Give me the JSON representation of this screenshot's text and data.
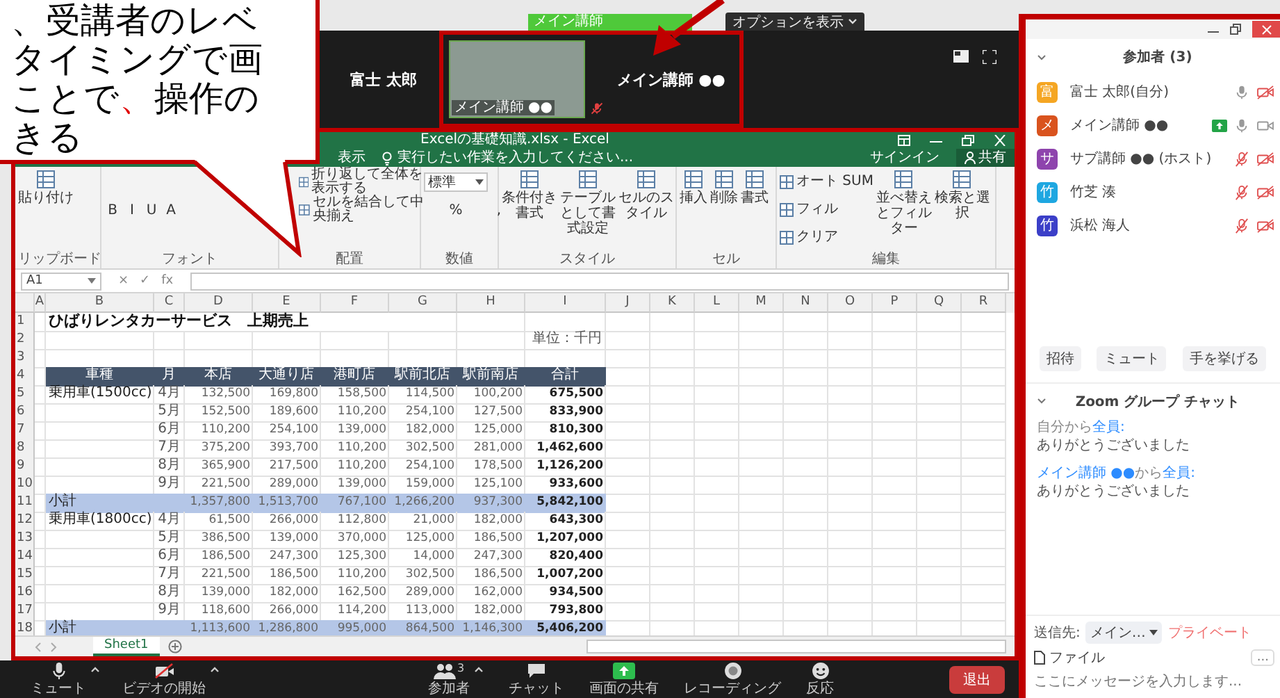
{
  "callout": {
    "lines": [
      [
        {
          "text": "、受講者のレベ",
          "highlight": false
        }
      ],
      [
        {
          "text": "タイミングで画",
          "highlight": false
        }
      ],
      [
        {
          "text": "ことで",
          "highlight": false
        },
        {
          "text": "、",
          "highlight": true
        },
        {
          "text": "操作の",
          "highlight": false
        }
      ],
      [
        {
          "text": "きる",
          "highlight": false
        }
      ]
    ]
  },
  "banner": {
    "text": "メイン講師"
  },
  "options_button": "オプションを表示",
  "video_bar": {
    "self_name": "富士 太郎",
    "speaker_tile_label": "メイン講師 ●●",
    "speaker_mic_muted": true,
    "speaker_name": "メイン講師 ●●"
  },
  "excel": {
    "title": "Excelの基礎知識.xlsx - Excel",
    "menu_tabs": [
      "表示"
    ],
    "tell_me": "実行したい作業を入力してください...",
    "sign_in": "サインイン",
    "share": "共有",
    "ribbon": [
      {
        "label": "リップボード",
        "items": [
          {
            "kind": "large",
            "text": "貼り付け"
          }
        ]
      },
      {
        "label": "フォント",
        "items": [
          {
            "kind": "glyph",
            "text": "B"
          },
          {
            "kind": "glyph",
            "text": "I"
          },
          {
            "kind": "glyph",
            "text": "U"
          },
          {
            "kind": "glyph",
            "text": "A"
          }
        ]
      },
      {
        "label": "配置",
        "items": [
          {
            "kind": "small",
            "text": "折り返して全体を表示する"
          },
          {
            "kind": "small",
            "text": "セルを結合して中央揃え"
          }
        ]
      },
      {
        "label": "数値",
        "items": [
          {
            "kind": "dropdown",
            "text": "標準"
          },
          {
            "kind": "glyph",
            "text": "%"
          },
          {
            "kind": "glyph",
            "text": ","
          }
        ]
      },
      {
        "label": "スタイル",
        "items": [
          {
            "kind": "large",
            "text": "条件付き書式"
          },
          {
            "kind": "large",
            "text": "テーブルとして書式設定"
          },
          {
            "kind": "large",
            "text": "セルのスタイル"
          }
        ]
      },
      {
        "label": "セル",
        "items": [
          {
            "kind": "large",
            "text": "挿入"
          },
          {
            "kind": "large",
            "text": "削除"
          },
          {
            "kind": "large",
            "text": "書式"
          }
        ]
      },
      {
        "label": "編集",
        "items": [
          {
            "kind": "small",
            "text": "オート SUM"
          },
          {
            "kind": "small",
            "text": "フィル"
          },
          {
            "kind": "small",
            "text": "クリア"
          },
          {
            "kind": "large",
            "text": "並べ替えとフィルター"
          },
          {
            "kind": "large",
            "text": "検索と選択"
          }
        ]
      }
    ],
    "name_box": "A1",
    "formula_buttons": [
      "×",
      "✓",
      "fx"
    ],
    "columns": [
      "A",
      "B",
      "C",
      "D",
      "E",
      "F",
      "G",
      "H",
      "I",
      "J",
      "K",
      "L",
      "M",
      "N",
      "O",
      "P",
      "Q",
      "R"
    ],
    "rows": [
      {
        "number": "1",
        "kind": "title",
        "text": "ひばりレンタカーサービス　上期売上"
      },
      {
        "number": "2",
        "kind": "unit",
        "text": "単位：千円"
      },
      {
        "number": "3",
        "kind": "blank"
      },
      {
        "number": "4",
        "kind": "header",
        "cells": [
          "車種",
          "月",
          "本店",
          "大通り店",
          "港町店",
          "駅前北店",
          "駅前南店",
          "合計"
        ]
      },
      {
        "number": "5",
        "kind": "data",
        "label": "乗用車(1500cc)",
        "month": "4月",
        "values": [
          "132,500",
          "169,800",
          "158,500",
          "114,500",
          "100,200"
        ],
        "total": "675,500"
      },
      {
        "number": "6",
        "kind": "data",
        "month": "5月",
        "values": [
          "152,500",
          "189,600",
          "110,200",
          "254,100",
          "127,500"
        ],
        "total": "833,900"
      },
      {
        "number": "7",
        "kind": "data",
        "month": "6月",
        "values": [
          "110,200",
          "254,100",
          "139,000",
          "182,000",
          "125,000"
        ],
        "total": "810,300"
      },
      {
        "number": "8",
        "kind": "data",
        "month": "7月",
        "values": [
          "375,200",
          "393,700",
          "110,200",
          "302,500",
          "281,000"
        ],
        "total": "1,462,600"
      },
      {
        "number": "9",
        "kind": "data",
        "month": "8月",
        "values": [
          "365,900",
          "217,500",
          "110,200",
          "254,100",
          "178,500"
        ],
        "total": "1,126,200"
      },
      {
        "number": "10",
        "kind": "data",
        "month": "9月",
        "values": [
          "221,500",
          "289,000",
          "139,000",
          "159,000",
          "125,100"
        ],
        "total": "933,600"
      },
      {
        "number": "11",
        "kind": "subtotal",
        "label": "小計",
        "values": [
          "1,357,800",
          "1,513,700",
          "767,100",
          "1,266,200",
          "937,300"
        ],
        "total": "5,842,100"
      },
      {
        "number": "12",
        "kind": "data",
        "label": "乗用車(1800cc)",
        "month": "4月",
        "values": [
          "61,500",
          "266,000",
          "112,800",
          "21,000",
          "182,000"
        ],
        "total": "643,300"
      },
      {
        "number": "13",
        "kind": "data",
        "month": "5月",
        "values": [
          "386,500",
          "139,000",
          "370,000",
          "125,000",
          "186,500"
        ],
        "total": "1,207,000"
      },
      {
        "number": "14",
        "kind": "data",
        "month": "6月",
        "values": [
          "186,500",
          "247,300",
          "125,300",
          "14,000",
          "247,300"
        ],
        "total": "820,400"
      },
      {
        "number": "15",
        "kind": "data",
        "month": "7月",
        "values": [
          "221,500",
          "186,500",
          "110,200",
          "302,500",
          "186,500"
        ],
        "total": "1,007,200"
      },
      {
        "number": "16",
        "kind": "data",
        "month": "8月",
        "values": [
          "139,000",
          "182,000",
          "162,500",
          "289,000",
          "162,000"
        ],
        "total": "934,500"
      },
      {
        "number": "17",
        "kind": "data",
        "month": "9月",
        "values": [
          "118,600",
          "266,000",
          "114,200",
          "113,000",
          "182,000"
        ],
        "total": "793,800"
      },
      {
        "number": "18",
        "kind": "subtotal",
        "label": "小計",
        "values": [
          "1,113,600",
          "1,286,800",
          "995,000",
          "864,500",
          "1,146,300"
        ],
        "total": "5,406,200"
      }
    ],
    "sheets": [
      {
        "label": "Sheet1",
        "selected": true
      }
    ]
  },
  "toolbar": {
    "items": [
      {
        "kind": "mic",
        "label": "ミュート",
        "menu": true
      },
      {
        "kind": "video-off",
        "label": "ビデオの開始",
        "menu": true
      },
      {
        "kind": "people",
        "label": "参加者",
        "count": "3",
        "menu": true
      },
      {
        "kind": "chat",
        "label": "チャット",
        "menu": false
      },
      {
        "kind": "share",
        "label": "画面の共有",
        "menu": false
      },
      {
        "kind": "record",
        "label": "レコーディング",
        "menu": false
      },
      {
        "kind": "reaction",
        "label": "反応",
        "menu": false
      }
    ],
    "leave_button": "退出"
  },
  "panel": {
    "title": "参加者 (3)",
    "participants": [
      {
        "initial": "富",
        "name": "富士 太郎(自分)",
        "color": "#f5a623",
        "sharing": false,
        "mic_muted": false,
        "video_off": true
      },
      {
        "initial": "メ",
        "name": "メイン講師 ●●",
        "color": "#d9531e",
        "sharing": true,
        "mic_muted": false,
        "video_off": false
      },
      {
        "initial": "サ",
        "name": "サブ講師 ●● (ホスト)",
        "color": "#8e44ad",
        "sharing": false,
        "mic_muted": true,
        "video_off": true
      },
      {
        "initial": "竹",
        "name": "竹芝 湊",
        "color": "#1ea7e1",
        "sharing": false,
        "mic_muted": true,
        "video_off": true
      },
      {
        "initial": "竹",
        "name": "浜松 海人",
        "color": "#3b3fc8",
        "sharing": false,
        "mic_muted": true,
        "video_off": true
      }
    ],
    "buttons": [
      "招待",
      "ミュート",
      "手を挙げる"
    ],
    "chat": {
      "title": "Zoom グループ チャット",
      "messages": [
        {
          "sender": "自分",
          "sender_highlight": false,
          "from_word": "から",
          "recipient": "全員:",
          "text": "ありがとうございました"
        },
        {
          "sender": "メイン講師 ●●",
          "sender_highlight": true,
          "from_word": "から",
          "recipient": "全員:",
          "text": "ありがとうございました"
        }
      ],
      "send_to_label": "送信先:",
      "recipient_dropdown": "メイン…",
      "private_label": "プライベート",
      "file_button": "ファイル",
      "more_button": "...",
      "input": {
        "placeholder": "ここにメッセージを入力します..."
      }
    }
  }
}
